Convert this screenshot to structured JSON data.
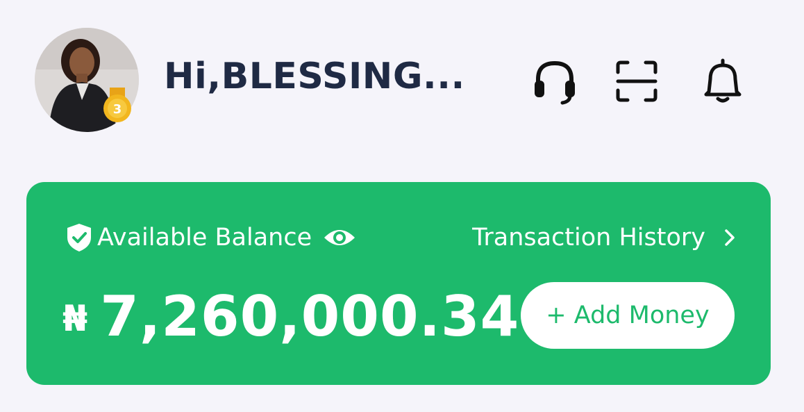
{
  "header": {
    "greeting": "Hi,BLESSING...",
    "avatar_badge_level": "3",
    "icons": [
      "headset-icon",
      "scan-icon",
      "bell-icon"
    ]
  },
  "card": {
    "balance_label": "Available Balance",
    "history_label": "Transaction History",
    "currency_symbol": "₦",
    "amount": "7,260,000.34",
    "add_money_label": "+ Add Money"
  },
  "colors": {
    "background": "#f5f4fa",
    "card": "#1dba6c",
    "text_dark": "#1f2a44",
    "white": "#ffffff"
  }
}
